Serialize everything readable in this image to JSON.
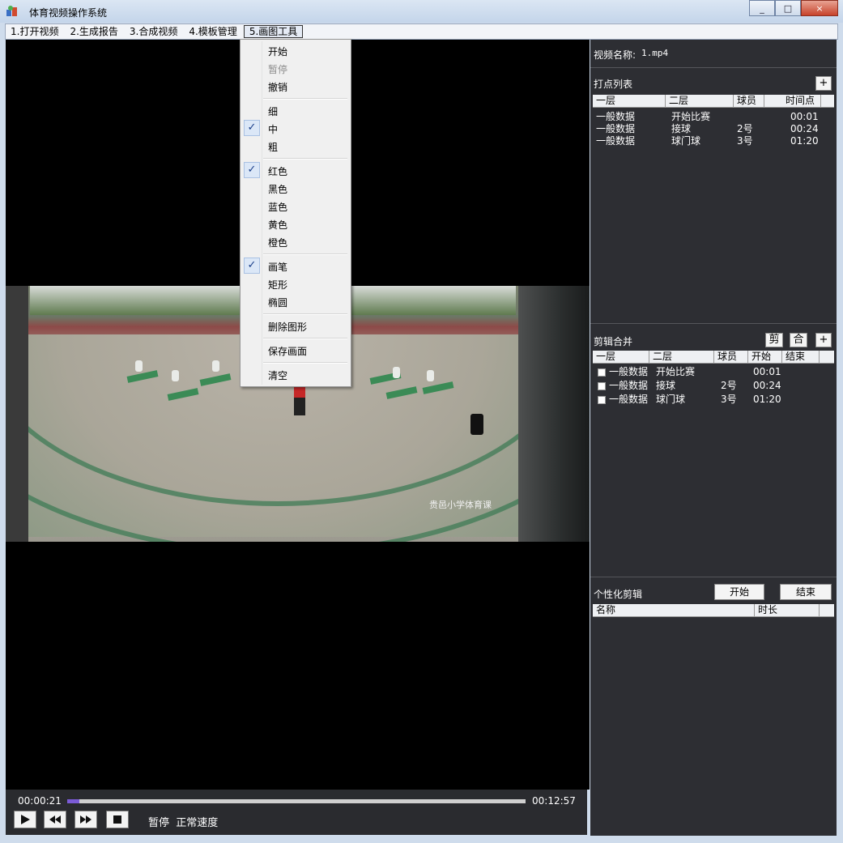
{
  "window": {
    "title": "体育视频操作系统",
    "controls": [
      "_",
      "□",
      "×"
    ]
  },
  "menu": {
    "items": [
      "1.打开视频",
      "2.生成报告",
      "3.合成视频",
      "4.模板管理",
      "5.画图工具"
    ]
  },
  "draw_menu": {
    "items": [
      {
        "label": "开始",
        "checked": false,
        "disabled": false
      },
      {
        "label": "暂停",
        "checked": false,
        "disabled": true
      },
      {
        "label": "撤销",
        "checked": false,
        "disabled": false
      },
      {
        "label": "细",
        "checked": false,
        "disabled": false
      },
      {
        "label": "中",
        "checked": true,
        "disabled": false
      },
      {
        "label": "粗",
        "checked": false,
        "disabled": false
      },
      {
        "label": "红色",
        "checked": true,
        "disabled": false
      },
      {
        "label": "黑色",
        "checked": false,
        "disabled": false
      },
      {
        "label": "蓝色",
        "checked": false,
        "disabled": false
      },
      {
        "label": "黄色",
        "checked": false,
        "disabled": false
      },
      {
        "label": "橙色",
        "checked": false,
        "disabled": false
      },
      {
        "label": "画笔",
        "checked": true,
        "disabled": false
      },
      {
        "label": "矩形",
        "checked": false,
        "disabled": false
      },
      {
        "label": "椭圆",
        "checked": false,
        "disabled": false
      },
      {
        "label": "删除图形",
        "checked": false,
        "disabled": false
      },
      {
        "label": "保存画面",
        "checked": false,
        "disabled": false
      },
      {
        "label": "清空",
        "checked": false,
        "disabled": false
      }
    ],
    "check_glyph": "✓"
  },
  "video": {
    "watermark": "贵邑小学体育课"
  },
  "player": {
    "current_time": "00:00:21",
    "total_time": "00:12:57",
    "progress_fraction": 0.027,
    "status": "暂停",
    "speed": "正常速度",
    "buttons": [
      "play-icon",
      "rewind-icon",
      "fast-forward-icon",
      "stop-icon"
    ]
  },
  "panel": {
    "video_name_label": "视频名称:",
    "video_name": "1.mp4",
    "marks": {
      "title": "打点列表",
      "add_label": "+",
      "headers": [
        "一层",
        "二层",
        "球员",
        "时间点"
      ],
      "rows": [
        [
          "一般数据",
          "开始比赛",
          "",
          "00:01"
        ],
        [
          "一般数据",
          "接球",
          "2号",
          "00:24"
        ],
        [
          "一般数据",
          "球门球",
          "3号",
          "01:20"
        ]
      ]
    },
    "merge": {
      "title": "剪辑合并",
      "cut_label": "剪",
      "merge_label": "合",
      "add_label": "+",
      "headers": [
        "一层",
        "二层",
        "球员",
        "开始",
        "结束"
      ],
      "rows": [
        [
          "一般数据",
          "开始比赛",
          "",
          "00:01",
          ""
        ],
        [
          "一般数据",
          "接球",
          "2号",
          "00:24",
          ""
        ],
        [
          "一般数据",
          "球门球",
          "3号",
          "01:20",
          ""
        ]
      ]
    },
    "custom": {
      "title": "个性化剪辑",
      "start_label": "开始",
      "end_label": "结束",
      "headers": [
        "名称",
        "时长"
      ]
    }
  }
}
